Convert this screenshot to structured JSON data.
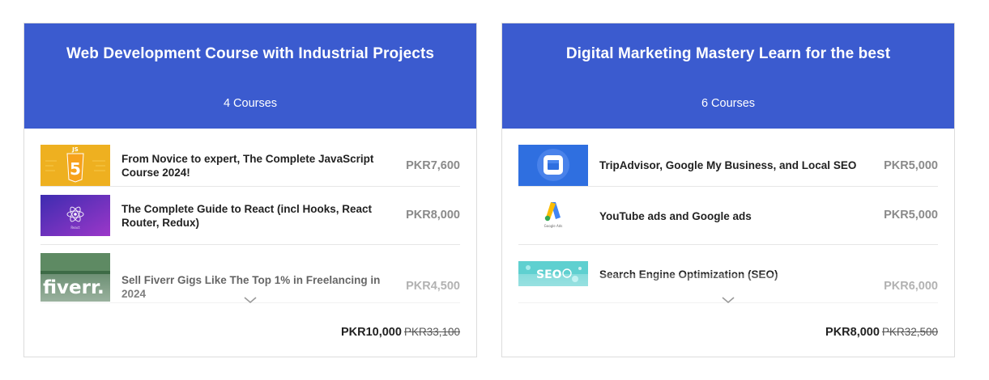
{
  "cards": [
    {
      "title": "Web Development Course with Industrial Projects",
      "count": "4 Courses",
      "courses": [
        {
          "name": "From Novice to expert, The Complete JavaScript Course 2024!",
          "price": "PKR7,600",
          "thumb": "javascript-html5-thumbnail"
        },
        {
          "name": "The Complete Guide to React (incl Hooks, React Router, Redux)",
          "price": "PKR8,000",
          "thumb": "react-thumbnail"
        },
        {
          "name": "Sell Fiverr Gigs Like The Top 1% in Freelancing in 2024",
          "price": "PKR4,500",
          "thumb": "fiverr-thumbnail",
          "thumb_text": "fiverr."
        }
      ],
      "total_price": "PKR10,000",
      "original_price": "PKR33,100"
    },
    {
      "title": "Digital Marketing Mastery Learn for the best",
      "count": "6 Courses",
      "courses": [
        {
          "name": "TripAdvisor, Google My Business, and Local SEO",
          "price": "PKR5,000",
          "thumb": "google-my-business-thumbnail"
        },
        {
          "name": "YouTube ads and Google ads",
          "price": "PKR5,000",
          "thumb": "google-ads-thumbnail",
          "thumb_text": "Google Ads"
        },
        {
          "name": "Search Engine Optimization (SEO)",
          "price": "PKR6,000",
          "thumb": "seo-thumbnail",
          "thumb_text": "SEO"
        }
      ],
      "total_price": "PKR8,000",
      "original_price": "PKR32,500"
    }
  ],
  "colors": {
    "header_bg": "#3b5bcf",
    "price_gray": "#8a8a8a"
  },
  "icons": {
    "expand": "chevron-down-icon"
  }
}
